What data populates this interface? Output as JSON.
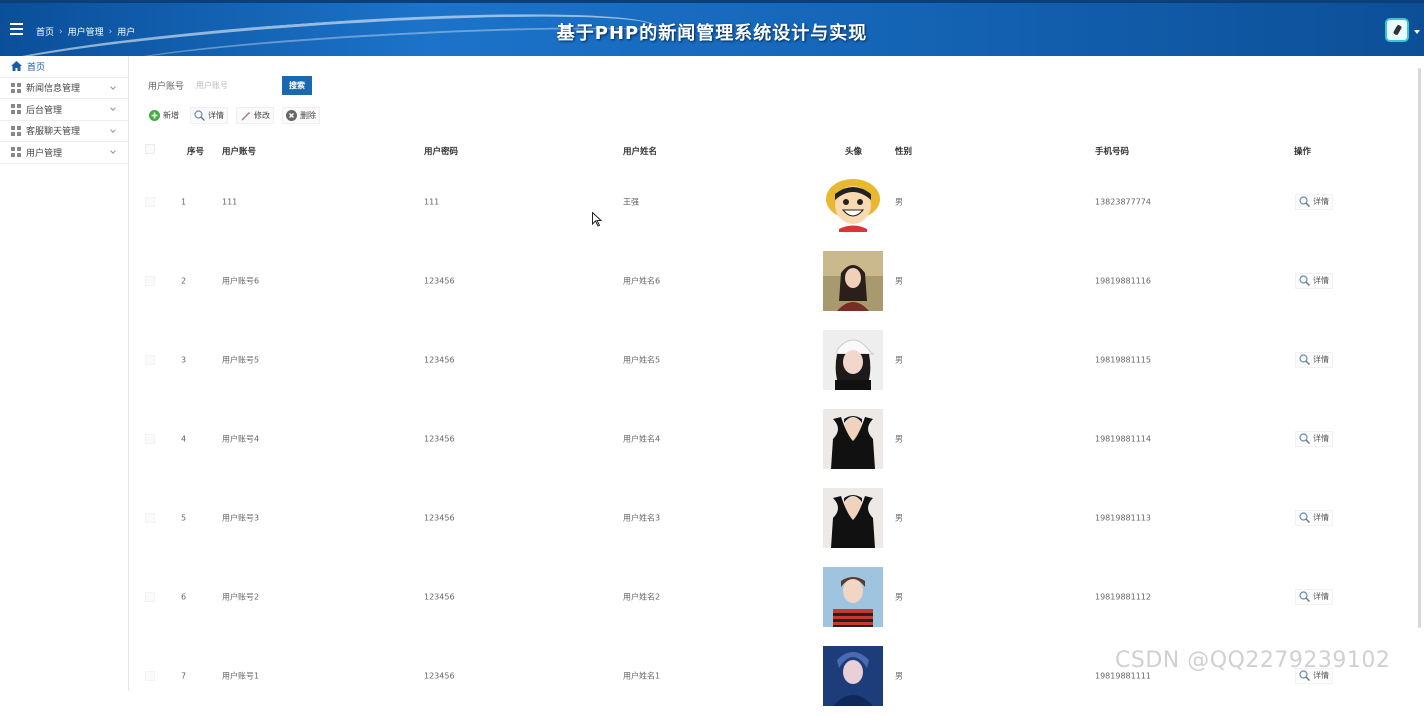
{
  "header": {
    "system_title": "基于PHP的新闻管理系统设计与实现",
    "breadcrumb": [
      "首页",
      "用户管理",
      "用户"
    ]
  },
  "sidebar": {
    "items": [
      {
        "label": "首页",
        "icon": "home-icon"
      },
      {
        "label": "新闻信息管理",
        "icon": "grid-icon"
      },
      {
        "label": "后台管理",
        "icon": "grid-icon"
      },
      {
        "label": "客服聊天管理",
        "icon": "grid-icon"
      },
      {
        "label": "用户管理",
        "icon": "grid-icon"
      }
    ]
  },
  "search": {
    "label": "用户账号",
    "placeholder": "用户账号",
    "button": "搜索"
  },
  "toolbar": {
    "add": "新增",
    "detail": "详情",
    "edit": "修改",
    "delete": "删除"
  },
  "table": {
    "headers": [
      "序号",
      "用户账号",
      "用户密码",
      "用户姓名",
      "头像",
      "性别",
      "手机号码",
      "操作"
    ],
    "rows": [
      {
        "no": "1",
        "account": "111",
        "password": "111",
        "name": "王强",
        "avatar": "cartoon-avatar",
        "gender": "男",
        "phone": "13823877774",
        "action": "详情"
      },
      {
        "no": "2",
        "account": "用户账号6",
        "password": "123456",
        "name": "用户姓名6",
        "avatar": "photo-woman-outdoor",
        "gender": "男",
        "phone": "19819881116",
        "action": "详情"
      },
      {
        "no": "3",
        "account": "用户账号5",
        "password": "123456",
        "name": "用户姓名5",
        "avatar": "photo-woman-cap",
        "gender": "男",
        "phone": "19819881115",
        "action": "详情"
      },
      {
        "no": "4",
        "account": "用户账号4",
        "password": "123456",
        "name": "用户姓名4",
        "avatar": "photo-man-black",
        "gender": "男",
        "phone": "19819881114",
        "action": "详情"
      },
      {
        "no": "5",
        "account": "用户账号3",
        "password": "123456",
        "name": "用户姓名3",
        "avatar": "photo-man-black",
        "gender": "男",
        "phone": "19819881113",
        "action": "详情"
      },
      {
        "no": "6",
        "account": "用户账号2",
        "password": "123456",
        "name": "用户姓名2",
        "avatar": "photo-man-stripes",
        "gender": "男",
        "phone": "19819881112",
        "action": "详情"
      },
      {
        "no": "7",
        "account": "用户账号1",
        "password": "123456",
        "name": "用户姓名1",
        "avatar": "photo-man-blue",
        "gender": "男",
        "phone": "19819881111",
        "action": "详情"
      }
    ]
  },
  "watermark": "CSDN @QQ2279239102",
  "colors": {
    "primary": "#1a69b0",
    "header_bg": "#1566b8"
  }
}
